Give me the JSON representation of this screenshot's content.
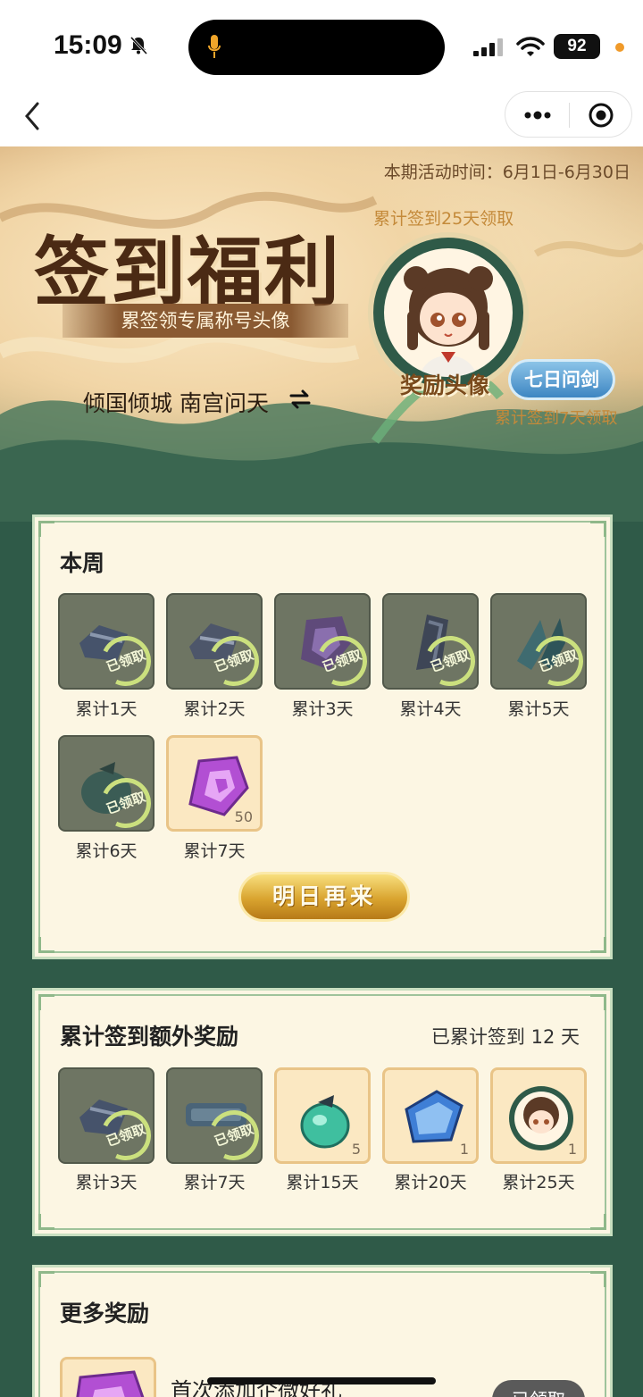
{
  "status_bar": {
    "time": "15:09",
    "battery": "92",
    "icons": [
      "bell-slash-icon",
      "microphone-icon",
      "cellular-signal-icon",
      "wifi-icon",
      "battery-icon",
      "privacy-dot-icon"
    ],
    "accent_colors": {
      "mic": "#f0a52a",
      "privacy_dot": "#f09a2a"
    }
  },
  "nav": {
    "icons": [
      "back-chevron-icon",
      "more-dots-icon",
      "target-icon"
    ]
  },
  "banner": {
    "period": "本期活动时间：6月1日-6月30日",
    "title": "签到福利",
    "subtitle": "累签领专属称号头像",
    "user_title": "倾国倾城 南宫问天",
    "top_note": "累计签到25天领取",
    "avatar_label": "奖励头像",
    "badge": "七日问剑",
    "bottom_note": "累计签到7天领取"
  },
  "week": {
    "title": "本周",
    "items": [
      {
        "label": "累计1天",
        "state": "claimed",
        "stamp": "已领取",
        "icon": "scroll-icon"
      },
      {
        "label": "累计2天",
        "state": "claimed",
        "stamp": "已领取",
        "icon": "scroll-icon"
      },
      {
        "label": "累计3天",
        "state": "claimed",
        "stamp": "已领取",
        "icon": "gem-icon"
      },
      {
        "label": "累计4天",
        "state": "claimed",
        "stamp": "已领取",
        "icon": "crystal-icon"
      },
      {
        "label": "累计5天",
        "state": "claimed",
        "stamp": "已领取",
        "icon": "crystal-icon"
      },
      {
        "label": "累计6天",
        "state": "claimed",
        "stamp": "已领取",
        "icon": "pouch-icon"
      },
      {
        "label": "累计7天",
        "state": "open",
        "qty": "50",
        "icon": "purple-gem-icon"
      }
    ],
    "button": "明日再来"
  },
  "cumulative": {
    "title": "累计签到额外奖励",
    "summary": "已累计签到 12 天",
    "items": [
      {
        "label": "累计3天",
        "state": "claimed",
        "stamp": "已领取",
        "icon": "scroll-icon"
      },
      {
        "label": "累计7天",
        "state": "claimed",
        "stamp": "已领取",
        "icon": "title-plaque-icon"
      },
      {
        "label": "累计15天",
        "state": "open",
        "qty": "5",
        "icon": "green-pouch-icon"
      },
      {
        "label": "累计20天",
        "state": "open",
        "qty": "1",
        "icon": "blue-scroll-icon"
      },
      {
        "label": "累计25天",
        "state": "open",
        "qty": "1",
        "icon": "avatar-frame-icon"
      }
    ]
  },
  "more": {
    "title": "更多奖励",
    "item_text": "首次添加企微好礼",
    "button": "已领取"
  }
}
